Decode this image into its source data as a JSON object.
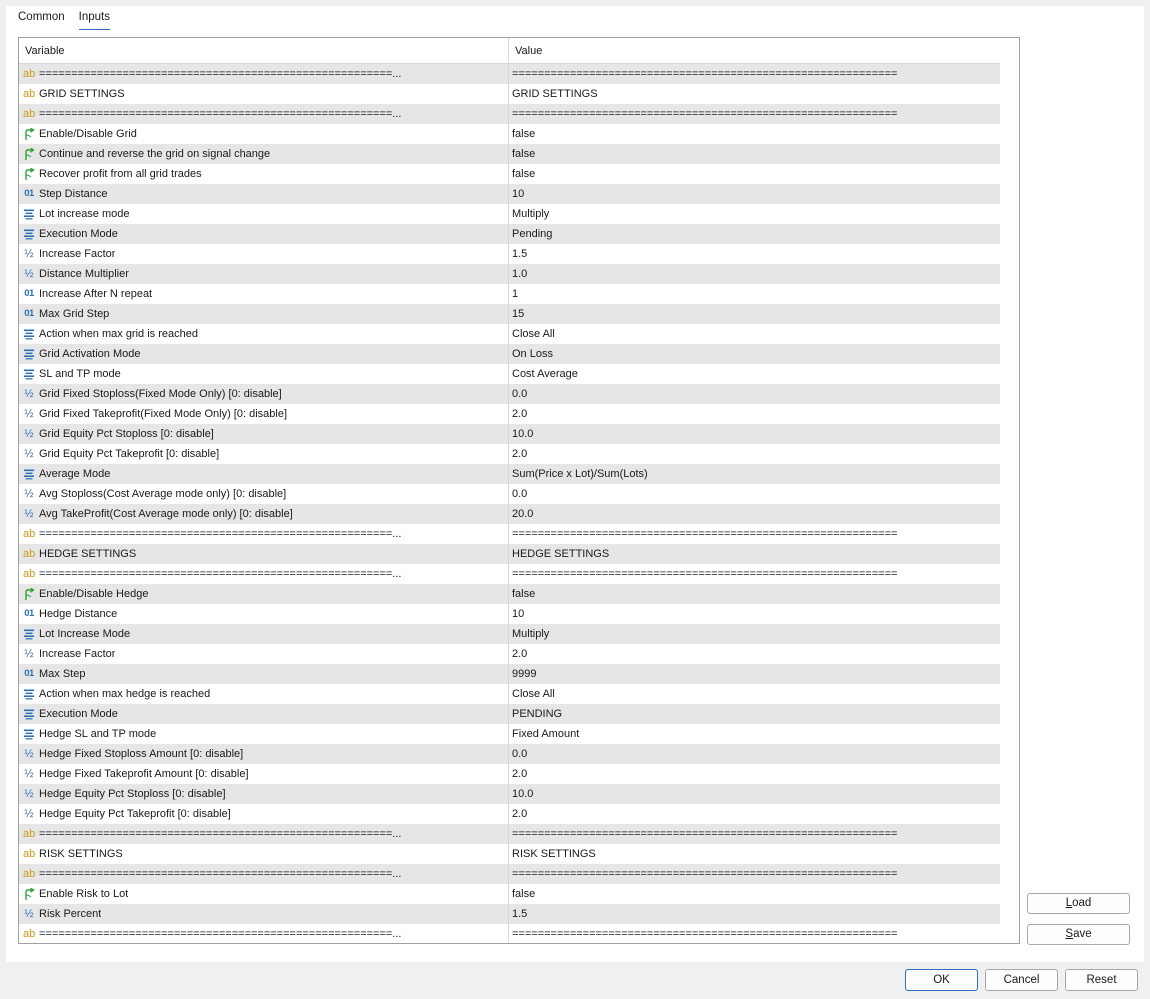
{
  "tabs": [
    {
      "label": "Common"
    },
    {
      "label": "Inputs"
    }
  ],
  "table": {
    "col_variable": "Variable",
    "col_value": "Value",
    "rows": [
      {
        "icon": "ab",
        "name": "=======================================================...",
        "value": "============================================================"
      },
      {
        "icon": "ab",
        "name": "GRID SETTINGS",
        "value": "GRID SETTINGS"
      },
      {
        "icon": "ab",
        "name": "=======================================================...",
        "value": "============================================================"
      },
      {
        "icon": "bool",
        "name": "Enable/Disable Grid",
        "value": "false"
      },
      {
        "icon": "bool",
        "name": "Continue and reverse the grid on signal change",
        "value": "false"
      },
      {
        "icon": "bool",
        "name": "Recover profit from all grid trades",
        "value": "false"
      },
      {
        "icon": "int",
        "name": "Step Distance",
        "value": "10"
      },
      {
        "icon": "enum",
        "name": "Lot increase mode",
        "value": "Multiply"
      },
      {
        "icon": "enum",
        "name": "Execution Mode",
        "value": "Pending"
      },
      {
        "icon": "double",
        "name": "Increase Factor",
        "value": "1.5"
      },
      {
        "icon": "double",
        "name": "Distance Multiplier",
        "value": "1.0"
      },
      {
        "icon": "int",
        "name": "Increase After N repeat",
        "value": "1"
      },
      {
        "icon": "int",
        "name": "Max Grid Step",
        "value": "15"
      },
      {
        "icon": "enum",
        "name": "Action when max grid is reached",
        "value": "Close All"
      },
      {
        "icon": "enum",
        "name": "Grid Activation Mode",
        "value": "On Loss"
      },
      {
        "icon": "enum",
        "name": "SL and TP mode",
        "value": "Cost Average"
      },
      {
        "icon": "double",
        "name": "Grid Fixed Stoploss(Fixed Mode Only) [0: disable]",
        "value": "0.0"
      },
      {
        "icon": "double",
        "name": "Grid Fixed Takeprofit(Fixed Mode Only) [0: disable]",
        "value": "2.0"
      },
      {
        "icon": "double",
        "name": "Grid Equity Pct Stoploss [0: disable]",
        "value": "10.0"
      },
      {
        "icon": "double",
        "name": "Grid Equity Pct Takeprofit [0: disable]",
        "value": "2.0"
      },
      {
        "icon": "enum",
        "name": "Average Mode",
        "value": "Sum(Price x Lot)/Sum(Lots)"
      },
      {
        "icon": "double",
        "name": "Avg Stoploss(Cost Average mode only) [0: disable]",
        "value": "0.0"
      },
      {
        "icon": "double",
        "name": "Avg TakeProfit(Cost Average mode only) [0: disable]",
        "value": "20.0"
      },
      {
        "icon": "ab",
        "name": "=======================================================...",
        "value": "============================================================"
      },
      {
        "icon": "ab",
        "name": "HEDGE SETTINGS",
        "value": "HEDGE SETTINGS"
      },
      {
        "icon": "ab",
        "name": "=======================================================...",
        "value": "============================================================"
      },
      {
        "icon": "bool",
        "name": "Enable/Disable Hedge",
        "value": "false"
      },
      {
        "icon": "int",
        "name": "Hedge Distance",
        "value": "10"
      },
      {
        "icon": "enum",
        "name": "Lot Increase Mode",
        "value": "Multiply"
      },
      {
        "icon": "double",
        "name": "Increase Factor",
        "value": "2.0"
      },
      {
        "icon": "int",
        "name": "Max Step",
        "value": "9999"
      },
      {
        "icon": "enum",
        "name": "Action when max hedge is reached",
        "value": "Close All"
      },
      {
        "icon": "enum",
        "name": "Execution Mode",
        "value": "PENDING"
      },
      {
        "icon": "enum",
        "name": "Hedge SL and TP mode",
        "value": "Fixed Amount"
      },
      {
        "icon": "double",
        "name": "Hedge Fixed Stoploss Amount [0: disable]",
        "value": "0.0"
      },
      {
        "icon": "double",
        "name": "Hedge Fixed Takeprofit Amount [0: disable]",
        "value": "2.0"
      },
      {
        "icon": "double",
        "name": "Hedge Equity Pct Stoploss [0: disable]",
        "value": "10.0"
      },
      {
        "icon": "double",
        "name": "Hedge Equity Pct Takeprofit [0: disable]",
        "value": "2.0"
      },
      {
        "icon": "ab",
        "name": "=======================================================...",
        "value": "============================================================"
      },
      {
        "icon": "ab",
        "name": "RISK SETTINGS",
        "value": "RISK SETTINGS"
      },
      {
        "icon": "ab",
        "name": "=======================================================...",
        "value": "============================================================"
      },
      {
        "icon": "bool",
        "name": "Enable Risk to Lot",
        "value": "false"
      },
      {
        "icon": "double",
        "name": "Risk Percent",
        "value": "1.5"
      },
      {
        "icon": "ab",
        "name": "=======================================================...",
        "value": "============================================================"
      }
    ]
  },
  "buttons": {
    "load": {
      "mnemonic": "L",
      "rest": "oad"
    },
    "save": {
      "mnemonic": "S",
      "rest": "ave"
    },
    "ok": "OK",
    "cancel": "Cancel",
    "reset": "Reset"
  },
  "icons": {
    "ab": {
      "name": "string-type-icon",
      "glyph": "ab",
      "color": "#c99a1a"
    },
    "bool": {
      "name": "bool-type-icon",
      "color": "#2f9e3a"
    },
    "int": {
      "name": "integer-type-icon",
      "glyph": "01",
      "color": "#2c6fb7"
    },
    "double": {
      "name": "double-type-icon",
      "glyph": "½",
      "color": "#2c6fb7"
    },
    "enum": {
      "name": "enum-type-icon",
      "color": "#2c6fb7"
    }
  }
}
